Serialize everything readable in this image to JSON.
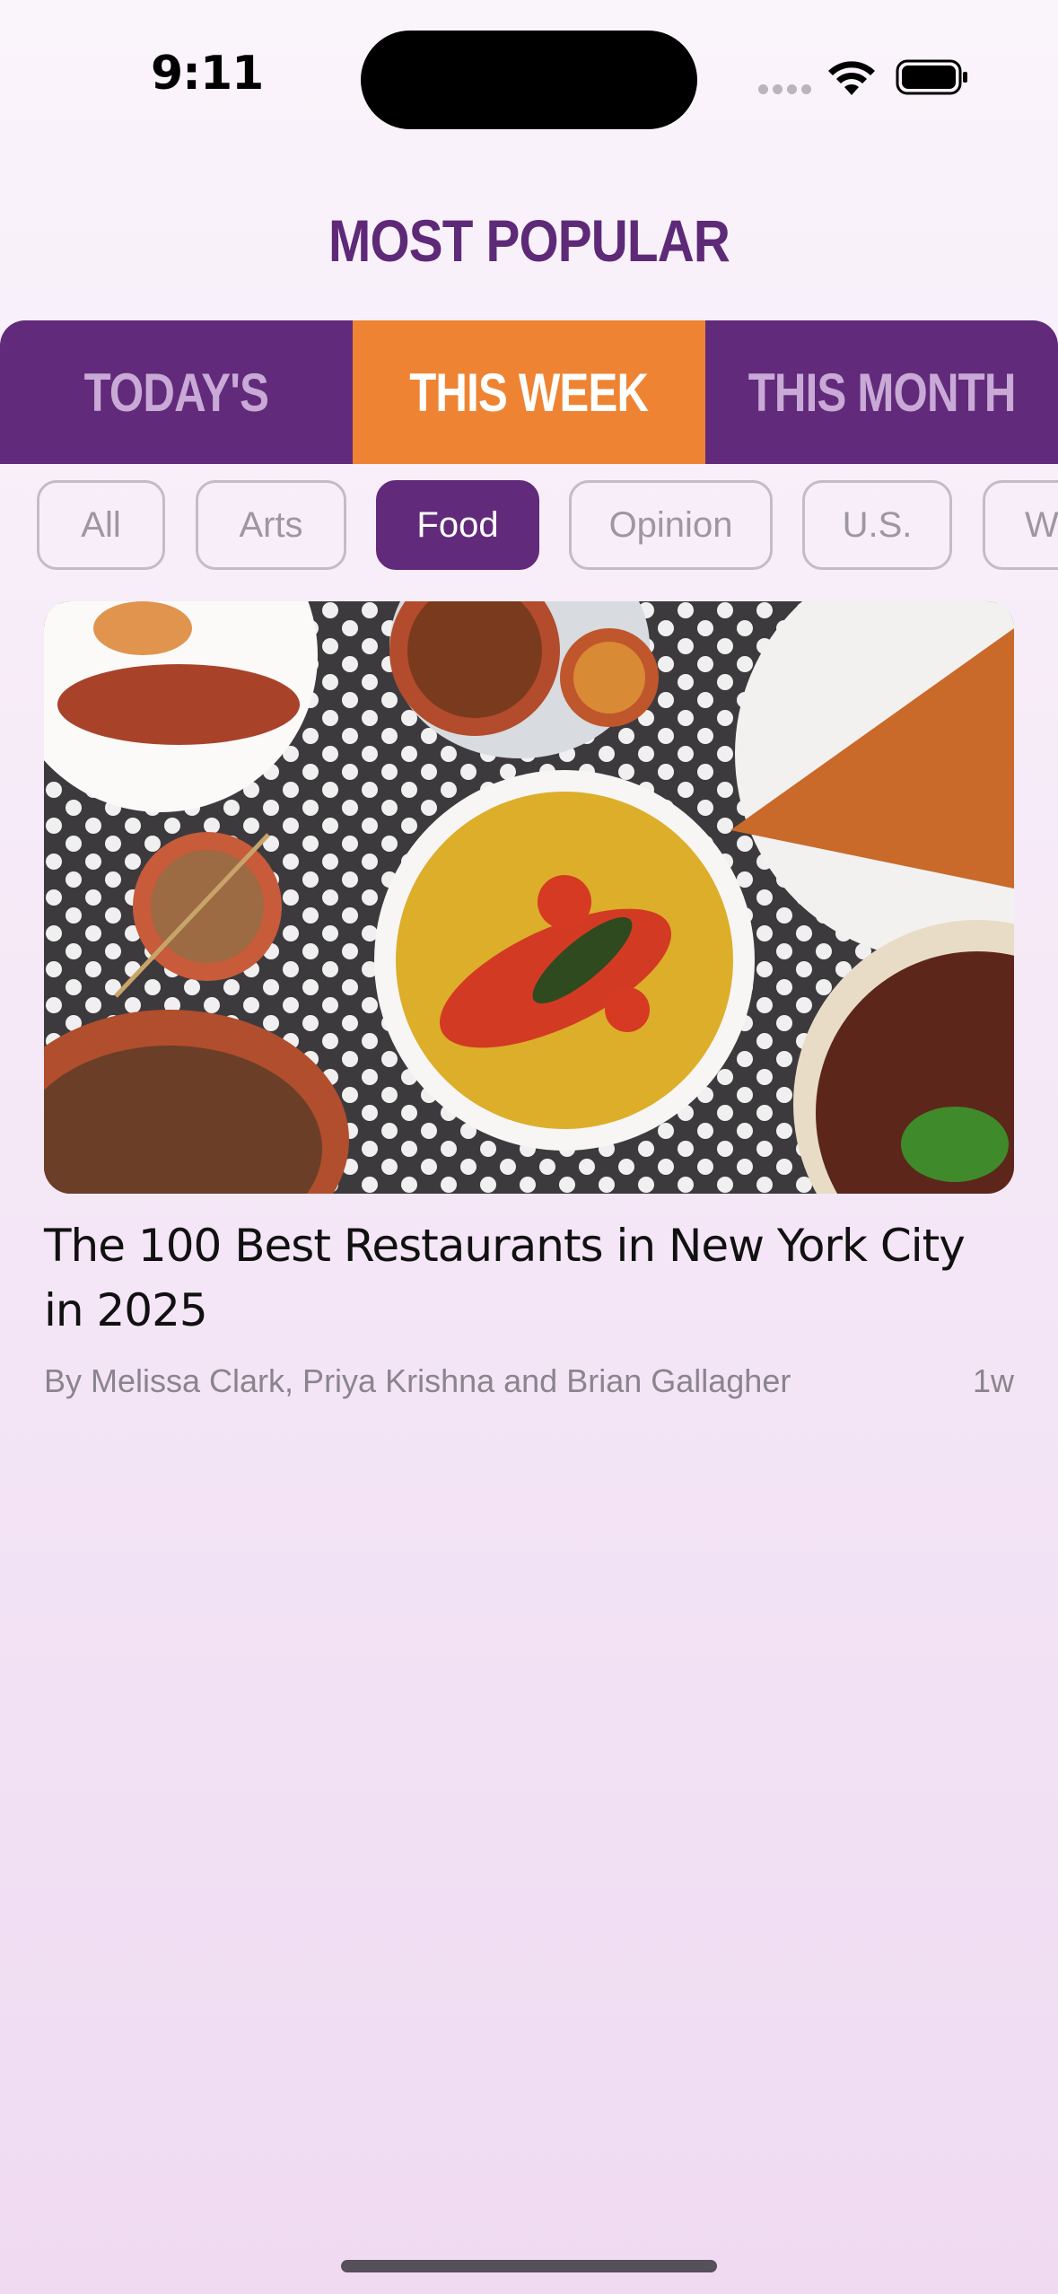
{
  "status_bar": {
    "time": "9:11"
  },
  "header": {
    "title": "MOST POPULAR"
  },
  "time_tabs": [
    {
      "label": "TODAY'S",
      "active": false
    },
    {
      "label": "THIS WEEK",
      "active": true
    },
    {
      "label": "THIS MONTH",
      "active": false
    }
  ],
  "categories": [
    {
      "label": "All",
      "active": false
    },
    {
      "label": "Arts",
      "active": false
    },
    {
      "label": "Food",
      "active": true
    },
    {
      "label": "Opinion",
      "active": false
    },
    {
      "label": "U.S.",
      "active": false
    },
    {
      "label": "World",
      "active": false
    }
  ],
  "article": {
    "title": "The 100 Best Restaurants in New York City in 2025",
    "byline": "By Melissa Clark, Priya Krishna and Brian Gallagher",
    "age": "1w"
  },
  "colors": {
    "brand_purple": "#622a7b",
    "accent_orange": "#ee8433"
  }
}
